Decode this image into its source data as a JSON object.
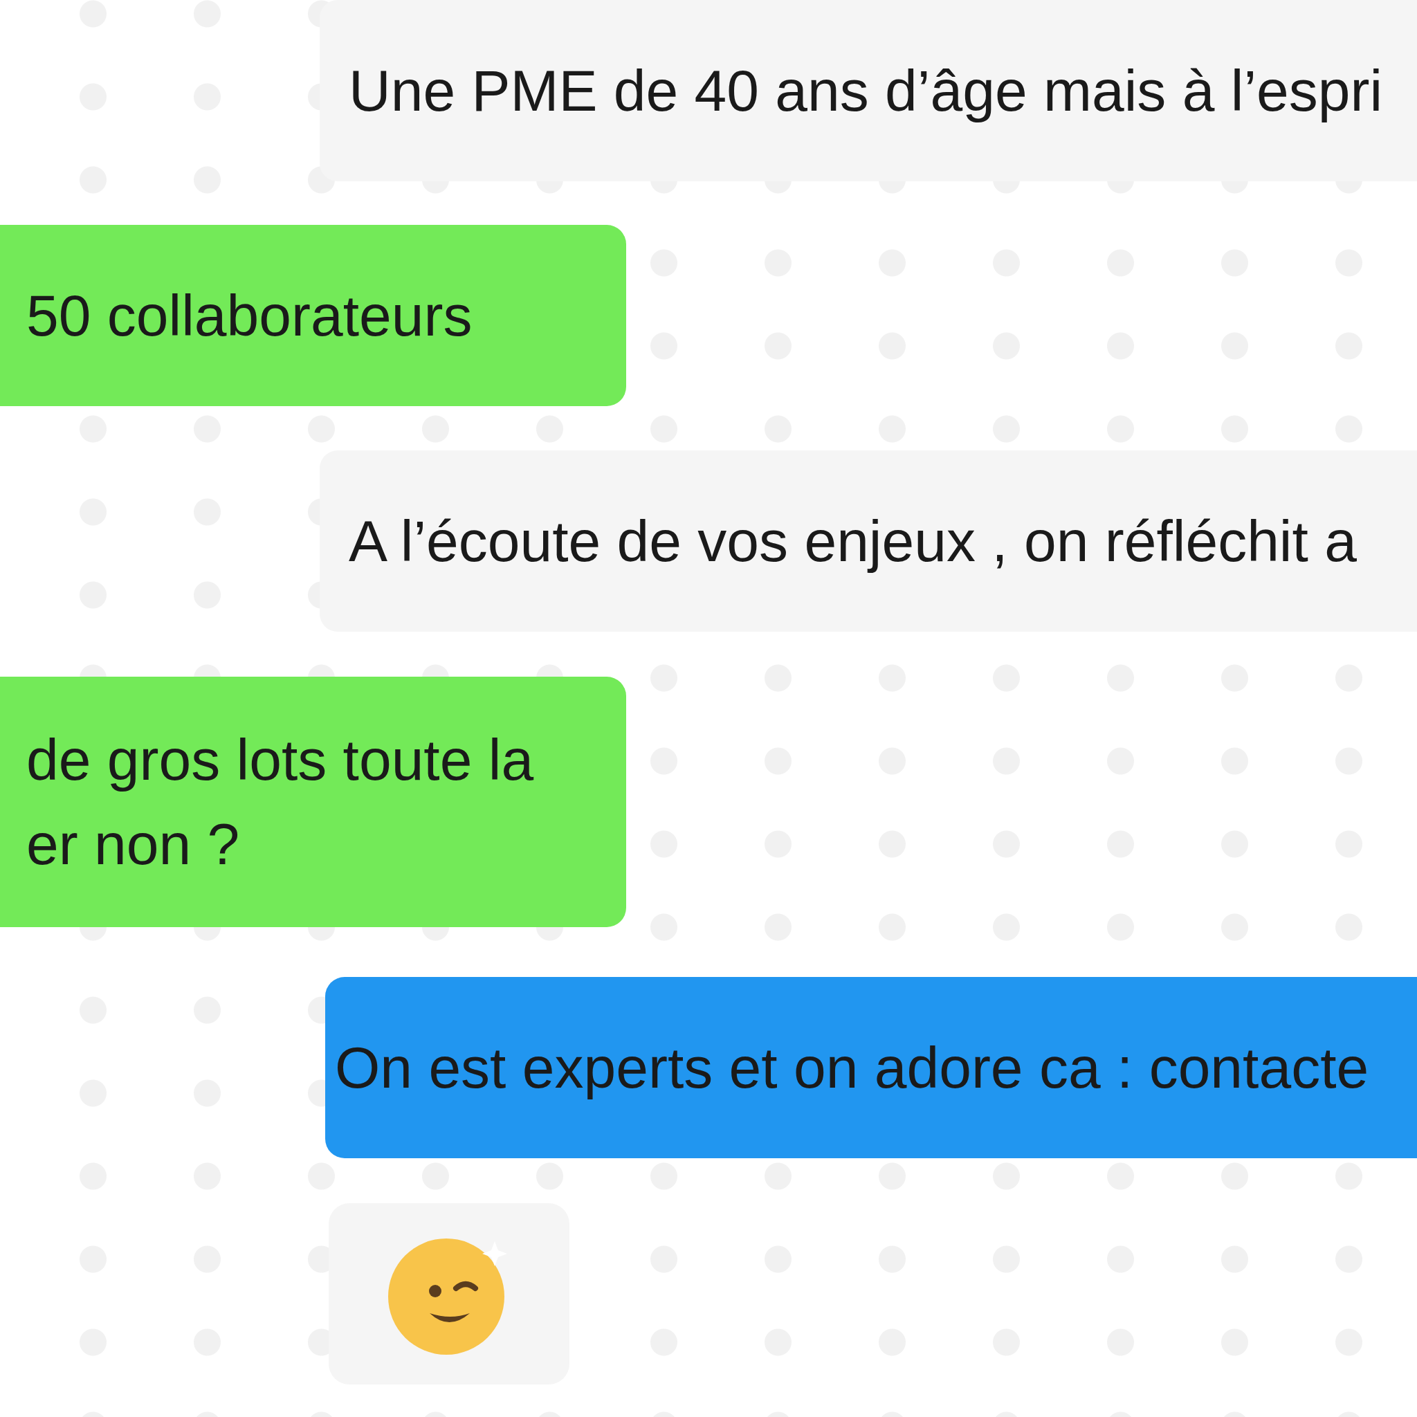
{
  "messages": [
    {
      "kind": "incoming",
      "lines": [
        "Une PME de 40 ans d’âge mais à l’espri"
      ]
    },
    {
      "kind": "outgoing",
      "lines": [
        "50 collaborateurs"
      ]
    },
    {
      "kind": "incoming",
      "lines": [
        "A l’écoute de vos enjeux , on réfléchit a"
      ]
    },
    {
      "kind": "outgoing",
      "lines": [
        "de gros lots toute la",
        "er non ?"
      ]
    },
    {
      "kind": "highlight",
      "lines": [
        "On est experts et on adore ca : contacte"
      ]
    },
    {
      "kind": "emoji"
    }
  ]
}
